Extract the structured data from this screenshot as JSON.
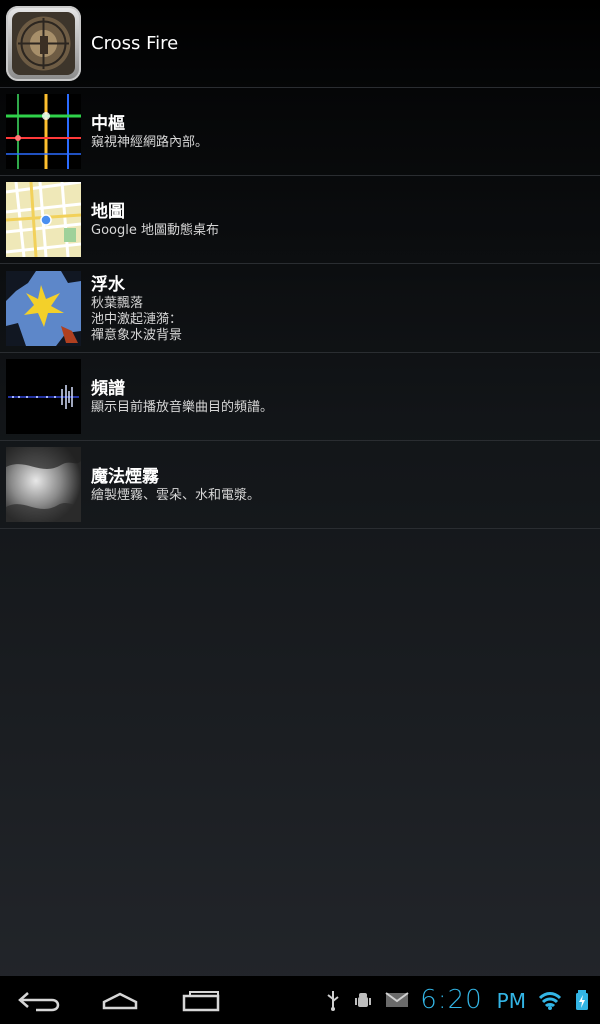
{
  "list": {
    "items": [
      {
        "title": "Cross Fire",
        "description": "",
        "icon": "crossfire-scope-icon"
      },
      {
        "title": "中樞",
        "description": "窺視神經網路內部。",
        "icon": "nexus-grid-icon"
      },
      {
        "title": "地圖",
        "description": "Google 地圖動態桌布",
        "icon": "map-icon"
      },
      {
        "title": "浮水",
        "description": "秋葉飄落\n池中激起漣漪：\n禪意象水波背景",
        "icon": "leaf-water-icon"
      },
      {
        "title": "頻譜",
        "description": "顯示目前播放音樂曲目的頻譜。",
        "icon": "spectrum-icon"
      },
      {
        "title": "魔法煙霧",
        "description": "繪製煙霧、雲朵、水和電漿。",
        "icon": "smoke-icon"
      }
    ]
  },
  "navbar": {
    "back_icon": "back-icon",
    "home_icon": "home-icon",
    "recents_icon": "recents-icon"
  },
  "status": {
    "time": "6:20",
    "ampm": "PM",
    "icons": [
      "usb-icon",
      "android-debug-icon",
      "gmail-icon",
      "wifi-icon",
      "battery-charging-icon"
    ],
    "accent": "#33b5e5"
  }
}
